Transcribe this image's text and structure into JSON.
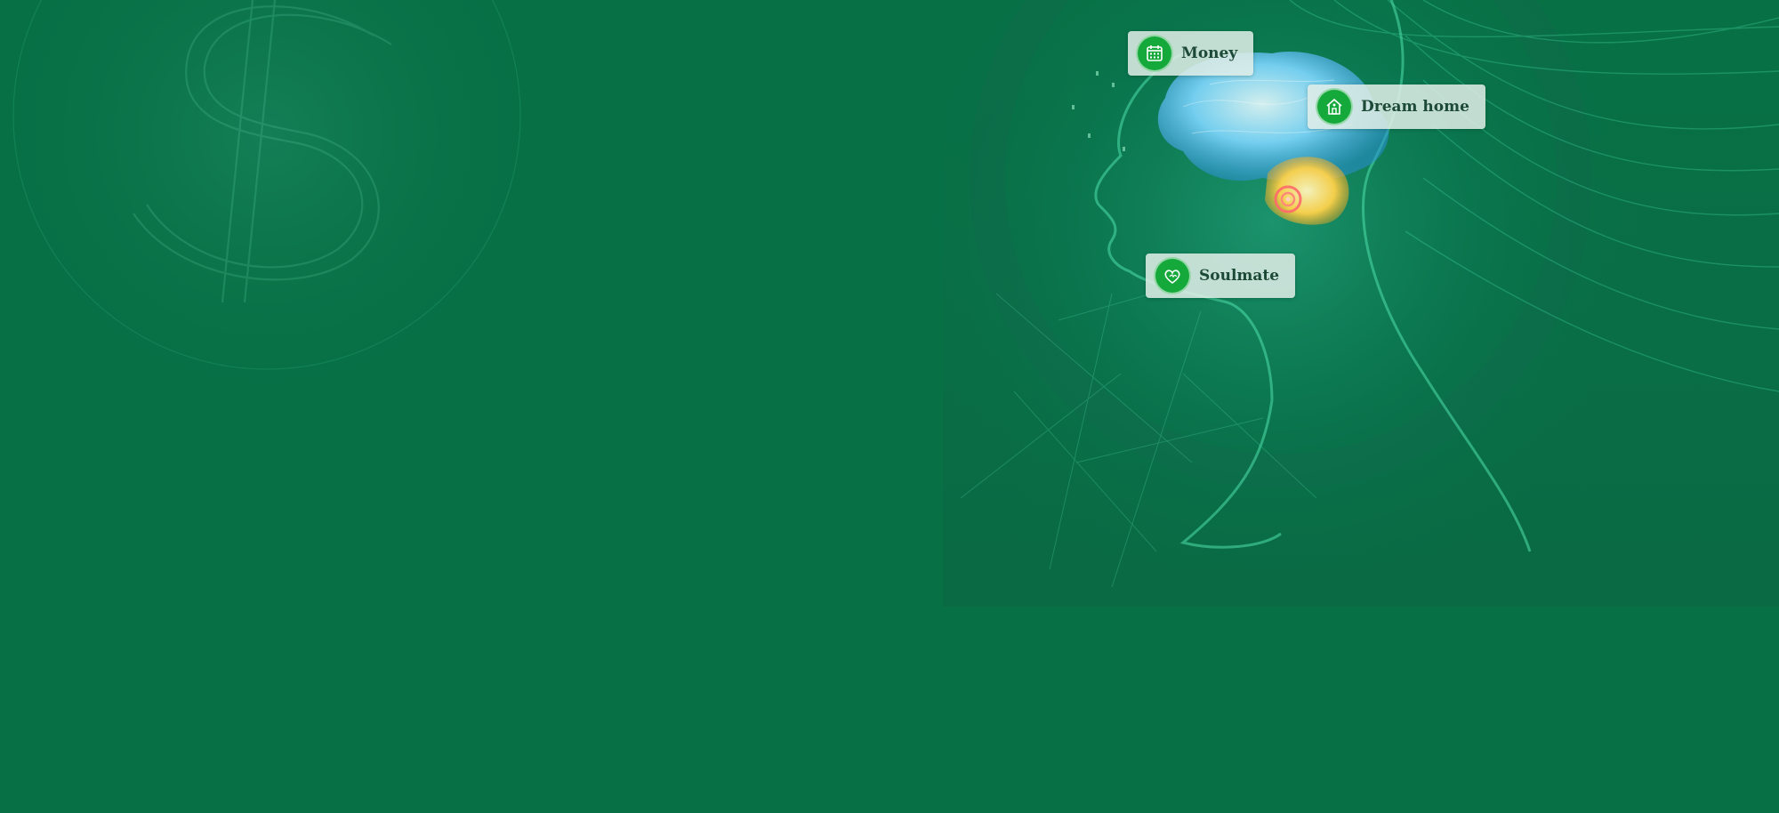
{
  "colors": {
    "background": "#087045",
    "icon_circle": "#15a93c",
    "label_text": "#1d4a37",
    "line_glow": "#3fd3a0",
    "brain_blue": "#6fd0ff",
    "brain_gold": "#ffd24a"
  },
  "tags": [
    {
      "label": "Money",
      "icon": "calendar-icon"
    },
    {
      "label": "Dream home",
      "icon": "house-icon"
    },
    {
      "label": "Soulmate",
      "icon": "hearts-icon"
    }
  ]
}
